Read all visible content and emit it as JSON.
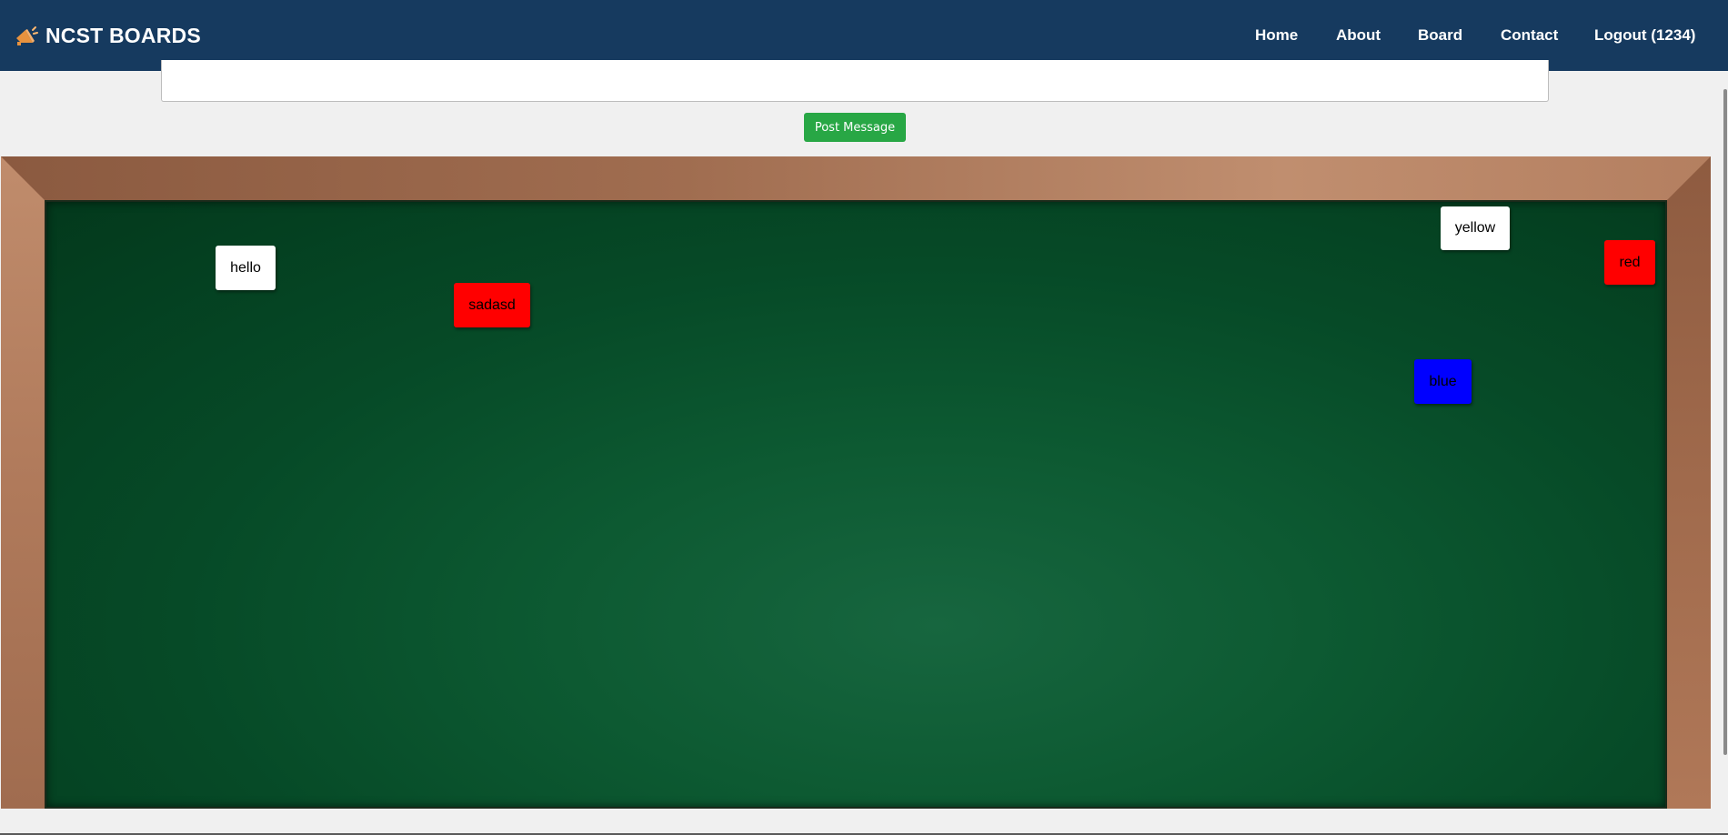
{
  "brand": {
    "name": "NCST BOARDS",
    "icon": "megaphone-icon"
  },
  "nav": {
    "home": "Home",
    "about": "About",
    "board": "Board",
    "contact": "Contact",
    "logout": "Logout (1234)"
  },
  "composer": {
    "message_value": "",
    "post_label": "Post Message"
  },
  "notes": [
    {
      "text": "hello",
      "color": "#ffffff"
    },
    {
      "text": "sadasd",
      "color": "#ff0000"
    },
    {
      "text": "yellow",
      "color": "#ffffff"
    },
    {
      "text": "red",
      "color": "#ff0000"
    },
    {
      "text": "blue",
      "color": "#0000ff"
    }
  ],
  "colors": {
    "navbar": "#163a5f",
    "post_button": "#28a745",
    "chalkboard": "#0d5a32",
    "frame": "#a5714f"
  }
}
